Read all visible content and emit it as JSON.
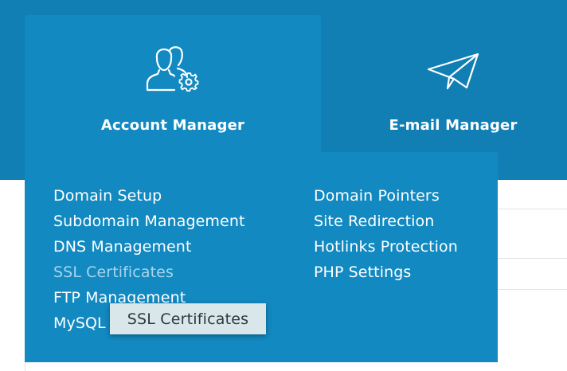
{
  "tabs": [
    {
      "label": "Account Manager",
      "icon": "users-gear-icon",
      "active": true
    },
    {
      "label": "E-mail Manager",
      "icon": "paper-plane-icon",
      "active": false
    }
  ],
  "account_menu": {
    "left_items": [
      "Domain Setup",
      "Subdomain Management",
      "DNS Management",
      "SSL Certificates",
      "FTP Management",
      "MySQL"
    ],
    "right_items": [
      "Domain Pointers",
      "Site Redirection",
      "Hotlinks Protection",
      "PHP Settings"
    ],
    "hovered_item": "SSL Certificates"
  },
  "tooltip": {
    "text": "SSL Certificates"
  },
  "colors": {
    "header_bg": "#117fb4",
    "active_bg": "#1289c1",
    "text": "#ffffff",
    "hover_text": "#a9d4ea",
    "tooltip_bg": "#d9e6ea"
  }
}
